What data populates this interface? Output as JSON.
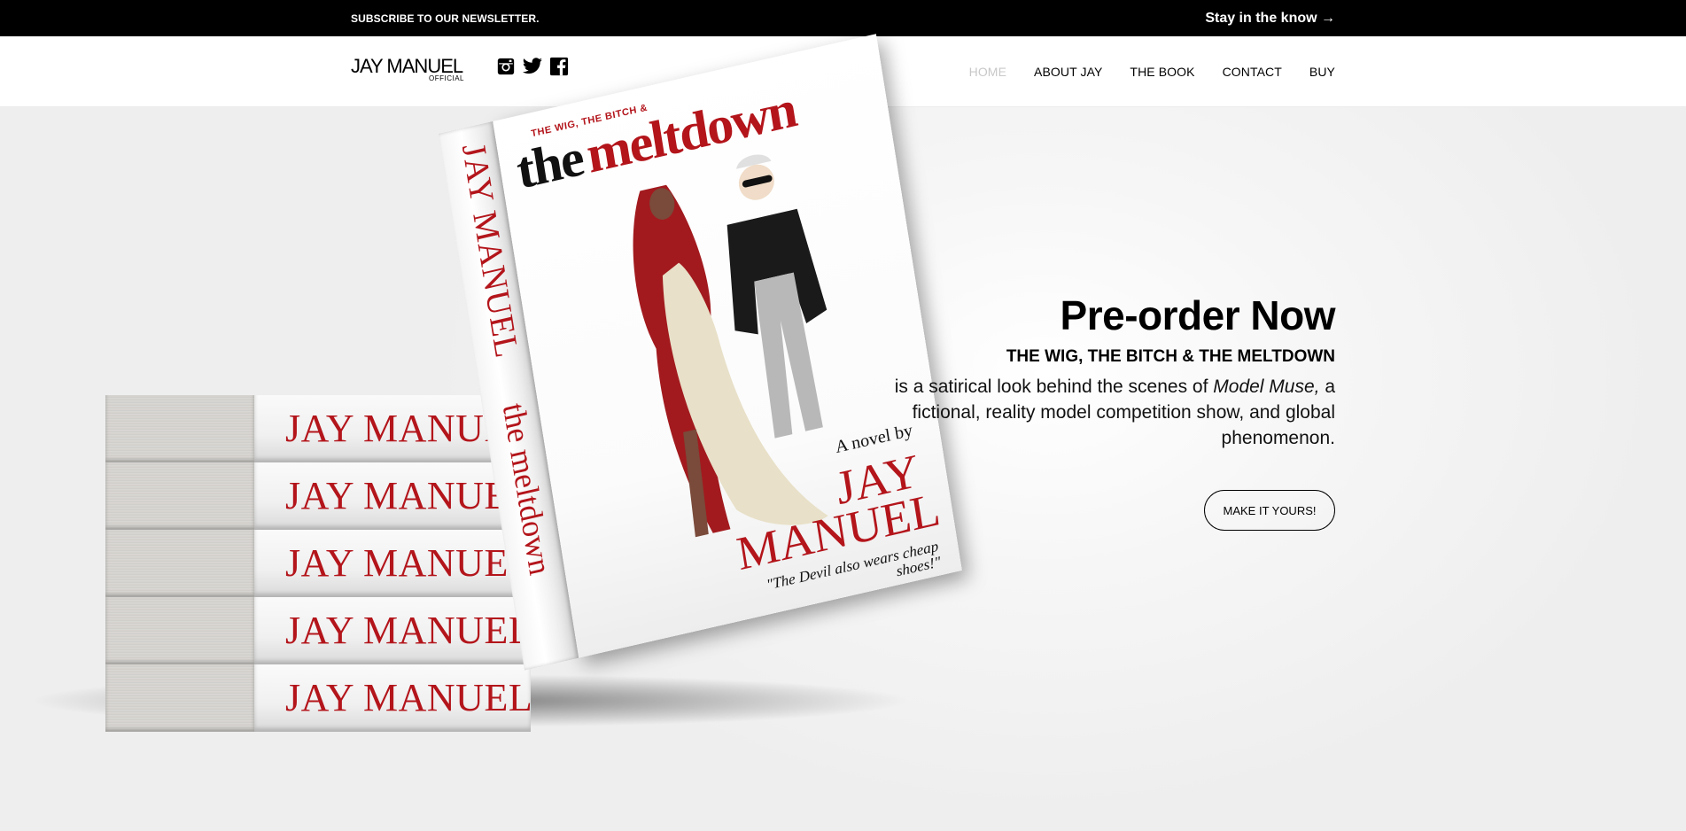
{
  "topbar": {
    "subscribe": "SUBSCRIBE TO OUR NEWSLETTER.",
    "stay_link": "Stay in the know →"
  },
  "header": {
    "logo_main": "JAY MANUEL",
    "logo_sub": "OFFICIAL",
    "social_icons": [
      "instagram-icon",
      "twitter-icon",
      "facebook-icon"
    ],
    "nav": [
      {
        "label": "HOME",
        "active": true
      },
      {
        "label": "ABOUT JAY",
        "active": false
      },
      {
        "label": "THE BOOK",
        "active": false
      },
      {
        "label": "CONTACT",
        "active": false
      },
      {
        "label": "BUY",
        "active": false
      }
    ]
  },
  "hero": {
    "heading": "Pre-order Now",
    "subheading": "THE WIG, THE BITCH & THE MELTDOWN",
    "body_before": "is a satirical look behind the scenes of ",
    "body_em": "Model Muse,",
    "body_after": " a fictional, reality model competition show, and global phenomenon.",
    "cta": "MAKE IT YOURS!"
  },
  "book": {
    "stack_label": "JAY MANUEL",
    "stack_rows": [
      "JAY MANUE",
      "JAY MANUEL",
      "JAY MANUEL",
      "JAY MANUEL",
      "JAY MANUEL"
    ],
    "cover_small": "THE WIG, THE BITCH &",
    "cover_the": "the",
    "cover_meltdown": "meltdown",
    "cover_novel": "A novel by",
    "cover_author1": "JAY",
    "cover_author2": "MANUEL",
    "cover_quote": "\"The Devil also wears cheap shoes!\"",
    "spine_author": "JAY MANUEL",
    "spine_title": "the meltdown"
  },
  "colors": {
    "brand_red": "#b3151b",
    "nav_active": "#c8c8c8",
    "topbar_bg": "#000000"
  }
}
